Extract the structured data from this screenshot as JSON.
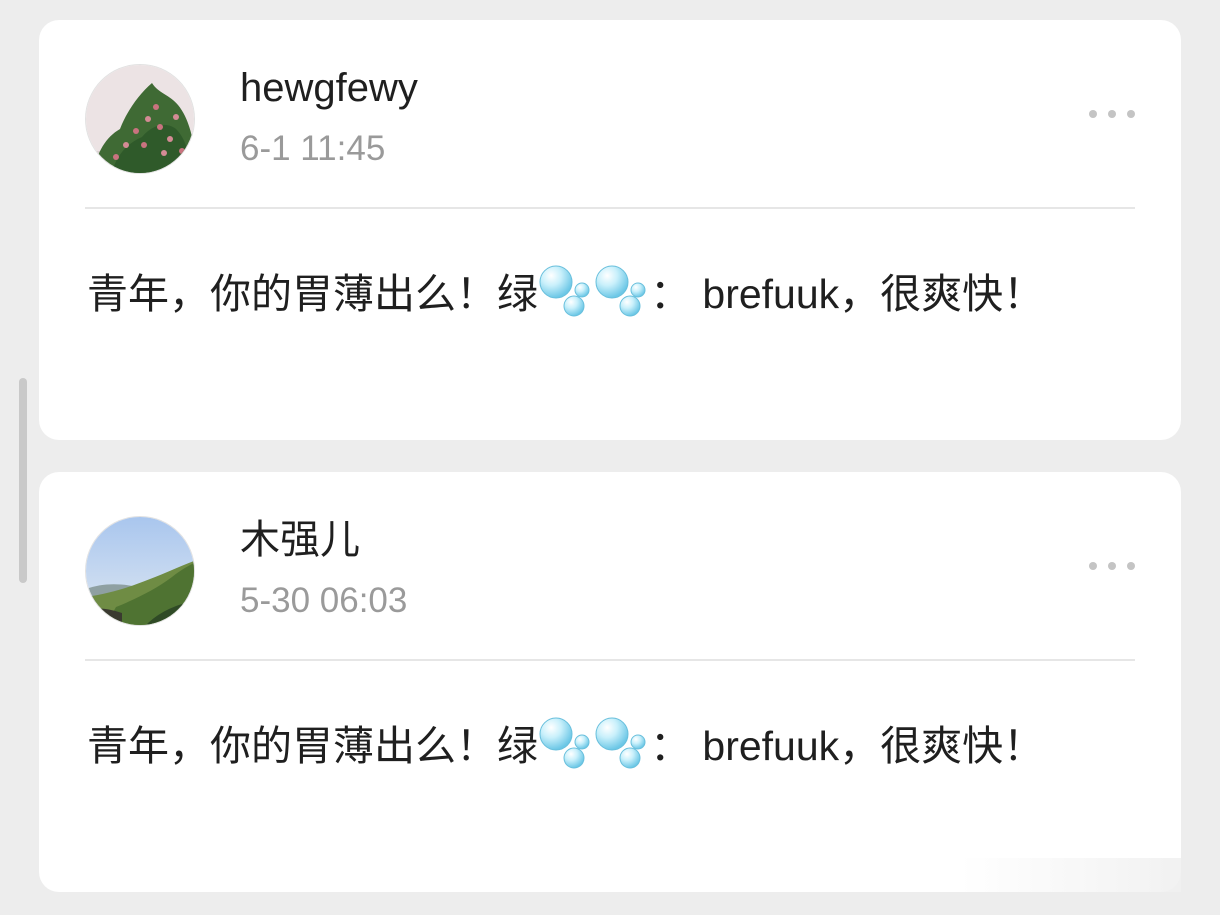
{
  "posts": [
    {
      "username": "hewgfewy",
      "time": "6-1 11:45",
      "text_before": "青年，你的胃薄出么！绿",
      "text_after": "： brefuuk，很爽快！",
      "emoji": [
        "bubbles-icon",
        "bubbles-icon"
      ],
      "avatar": "flowering-tree-avatar"
    },
    {
      "username": "木强儿",
      "time": "5-30 06:03",
      "text_before": "青年，你的胃薄出么！绿",
      "text_after": "： brefuuk，很爽快！",
      "emoji": [
        "bubbles-icon",
        "bubbles-icon"
      ],
      "avatar": "mountain-landscape-avatar"
    }
  ],
  "colors": {
    "page_background": "#ededed",
    "card": "#ffffff",
    "text": "#1f1f1f",
    "muted": "#9a9a9a"
  }
}
